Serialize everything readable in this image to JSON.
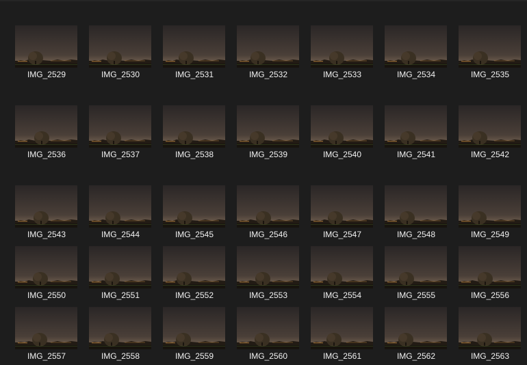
{
  "explorer": {
    "view": "Large icons",
    "files": [
      {
        "name": "IMG_2529"
      },
      {
        "name": "IMG_2530"
      },
      {
        "name": "IMG_2531"
      },
      {
        "name": "IMG_2532"
      },
      {
        "name": "IMG_2533"
      },
      {
        "name": "IMG_2534"
      },
      {
        "name": "IMG_2535"
      },
      {
        "name": "IMG_2536"
      },
      {
        "name": "IMG_2537"
      },
      {
        "name": "IMG_2538"
      },
      {
        "name": "IMG_2539"
      },
      {
        "name": "IMG_2540"
      },
      {
        "name": "IMG_2541"
      },
      {
        "name": "IMG_2542"
      },
      {
        "name": "IMG_2543"
      },
      {
        "name": "IMG_2544"
      },
      {
        "name": "IMG_2545"
      },
      {
        "name": "IMG_2546"
      },
      {
        "name": "IMG_2547"
      },
      {
        "name": "IMG_2548"
      },
      {
        "name": "IMG_2549"
      },
      {
        "name": "IMG_2550"
      },
      {
        "name": "IMG_2551"
      },
      {
        "name": "IMG_2552"
      },
      {
        "name": "IMG_2553"
      },
      {
        "name": "IMG_2554"
      },
      {
        "name": "IMG_2555"
      },
      {
        "name": "IMG_2556"
      },
      {
        "name": "IMG_2557"
      },
      {
        "name": "IMG_2558"
      },
      {
        "name": "IMG_2559"
      },
      {
        "name": "IMG_2560"
      },
      {
        "name": "IMG_2561"
      },
      {
        "name": "IMG_2562"
      },
      {
        "name": "IMG_2563"
      }
    ]
  },
  "colors": {
    "background": "#1d1d1d",
    "caption_text": "#f0f0f0",
    "sky_top": "#2a2626",
    "sky_horizon": "#6a5a4c",
    "ground": "#17130e",
    "tree": "#3a3022",
    "town_lights": "#f2a84a"
  }
}
